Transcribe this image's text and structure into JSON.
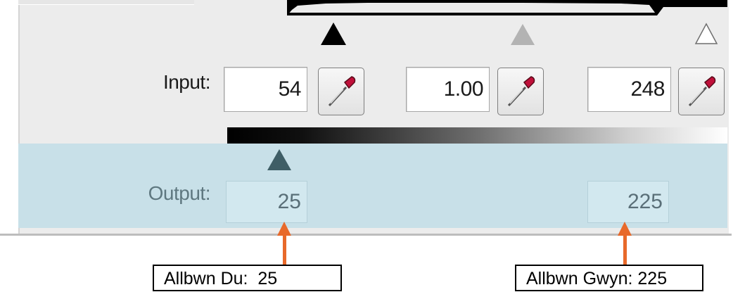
{
  "levels": {
    "input": {
      "label": "Input:",
      "black_value": "54",
      "gamma_value": "1.00",
      "white_value": "248"
    },
    "output": {
      "label": "Output:",
      "black_value": "25",
      "white_value": "225"
    }
  },
  "annotations": {
    "black_callout": "Allbwn Du:  25",
    "white_callout": "Allbwn Gwyn: 225"
  },
  "icons": {
    "eyedropper": "eyedropper-icon",
    "slider_black": "black-triangle-icon",
    "slider_gray": "gray-triangle-icon",
    "slider_white": "white-triangle-icon"
  },
  "colors": {
    "output_band": "#c8e0e8",
    "annotation_arrow": "#e8692a",
    "output_slider": "#3f5e66"
  }
}
